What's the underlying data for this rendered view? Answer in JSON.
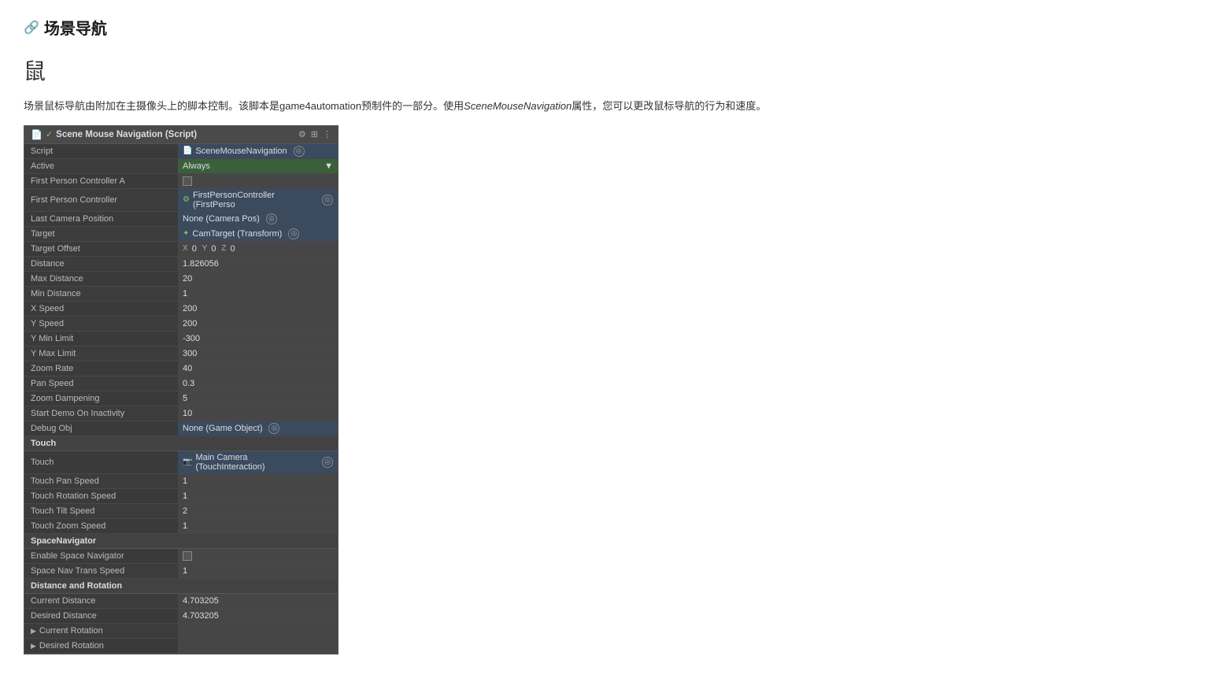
{
  "page": {
    "title": "场景导航",
    "mouse_icon": "鼠",
    "description_parts": [
      "场景鼠标导航由附加在主摄像头上的脚本控制。该脚本是game4automation预制件的一部分。使用",
      "SceneMouseNavigation",
      "属性，您可以更改鼠标导航的行为和速度。"
    ]
  },
  "inspector": {
    "header": {
      "title": "Scene Mouse Navigation (Script)",
      "icons": [
        "⚙",
        "⊞",
        "⋮"
      ]
    },
    "rows": [
      {
        "label": "Script",
        "value": "SceneMouseNavigation",
        "type": "ref",
        "icon": "file"
      },
      {
        "label": "Active",
        "value": "Always",
        "type": "dropdown"
      },
      {
        "label": "First Person Controller A",
        "value": "",
        "type": "checkbox"
      },
      {
        "label": "First Person Controller",
        "value": "FirstPersonController (FirstPerso",
        "type": "ref",
        "icon": "gear"
      },
      {
        "label": "Last Camera Position",
        "value": "None (Camera Pos)",
        "type": "ref-plain"
      },
      {
        "label": "Target",
        "value": "CamTarget (Transform)",
        "type": "ref",
        "icon": "target"
      },
      {
        "label": "Target Offset",
        "value": "",
        "type": "xyz",
        "x": "0",
        "y": "0",
        "z": "0"
      },
      {
        "label": "Distance",
        "value": "1.826056",
        "type": "number"
      },
      {
        "label": "Max Distance",
        "value": "20",
        "type": "number"
      },
      {
        "label": "Min Distance",
        "value": "1",
        "type": "number"
      },
      {
        "label": "X Speed",
        "value": "200",
        "type": "number"
      },
      {
        "label": "Y Speed",
        "value": "200",
        "type": "number"
      },
      {
        "label": "Y Min Limit",
        "value": "-300",
        "type": "number"
      },
      {
        "label": "Y Max Limit",
        "value": "300",
        "type": "number"
      },
      {
        "label": "Zoom Rate",
        "value": "40",
        "type": "number"
      },
      {
        "label": "Pan Speed",
        "value": "0.3",
        "type": "number"
      },
      {
        "label": "Zoom Dampening",
        "value": "5",
        "type": "number"
      },
      {
        "label": "Start Demo On Inactivity",
        "value": "10",
        "type": "number"
      },
      {
        "label": "Debug Obj",
        "value": "None (Game Object)",
        "type": "ref-plain"
      }
    ],
    "sections": {
      "touch": {
        "label": "Touch",
        "rows": [
          {
            "label": "Touch",
            "value": "Main Camera (TouchInteraction)",
            "type": "ref",
            "icon": "camera"
          },
          {
            "label": "Touch Pan Speed",
            "value": "1",
            "type": "number"
          },
          {
            "label": "Touch Rotation Speed",
            "value": "1",
            "type": "number"
          },
          {
            "label": "Touch Tilt Speed",
            "value": "2",
            "type": "number"
          },
          {
            "label": "Touch Zoom Speed",
            "value": "1",
            "type": "number"
          }
        ]
      },
      "space_navigator": {
        "label": "SpaceNavigator",
        "rows": [
          {
            "label": "Enable Space Navigator",
            "value": "",
            "type": "checkbox"
          },
          {
            "label": "Space Nav Trans Speed",
            "value": "1",
            "type": "number"
          }
        ]
      },
      "distance_rotation": {
        "label": "Distance and Rotation",
        "rows": [
          {
            "label": "Current Distance",
            "value": "4.703205",
            "type": "number"
          },
          {
            "label": "Desired Distance",
            "value": "4.703205",
            "type": "number"
          },
          {
            "label": "Current Rotation",
            "value": "",
            "type": "expand"
          },
          {
            "label": "Desired Rotation",
            "value": "",
            "type": "expand"
          }
        ]
      }
    }
  }
}
